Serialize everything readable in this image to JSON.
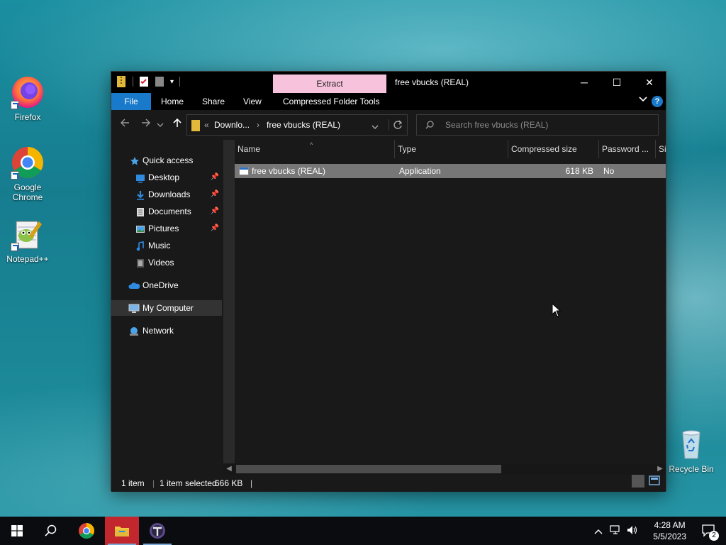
{
  "desktop": {
    "icons": [
      {
        "label": "Firefox"
      },
      {
        "label": "Google Chrome"
      },
      {
        "label": "Notepad++"
      },
      {
        "label": "Recycle Bin"
      }
    ]
  },
  "window": {
    "title": "free vbucks (REAL)",
    "context_tab": "Extract",
    "ribbon_tabs": [
      "File",
      "Home",
      "Share",
      "View",
      "Compressed Folder Tools"
    ],
    "controls": {
      "minimize": "─",
      "maximize": "☐",
      "close": "✕"
    },
    "address": {
      "overflow": "«",
      "crumbs": [
        "Downlo...",
        "free vbucks (REAL)"
      ]
    },
    "search": {
      "placeholder": "Search free vbucks (REAL)"
    },
    "nav": {
      "quick_access": "Quick access",
      "items": [
        "Desktop",
        "Downloads",
        "Documents",
        "Pictures",
        "Music",
        "Videos"
      ],
      "onedrive": "OneDrive",
      "my_computer": "My Computer",
      "network": "Network"
    },
    "columns": [
      "Name",
      "Type",
      "Compressed size",
      "Password ...",
      "Si"
    ],
    "files": [
      {
        "name": "free vbucks (REAL)",
        "type": "Application",
        "compressed_size": "618 KB",
        "password": "No"
      }
    ],
    "status": {
      "count": "1 item",
      "selected": "1 item selected",
      "size": "666 KB"
    }
  },
  "taskbar": {
    "clock_time": "4:28 AM",
    "clock_date": "5/5/2023",
    "notification_count": "2"
  },
  "colors": {
    "file_tab": "#1979ca",
    "context_tab": "#f7c2dc",
    "selection": "#777777",
    "active_taskbar": "#c1272d"
  }
}
